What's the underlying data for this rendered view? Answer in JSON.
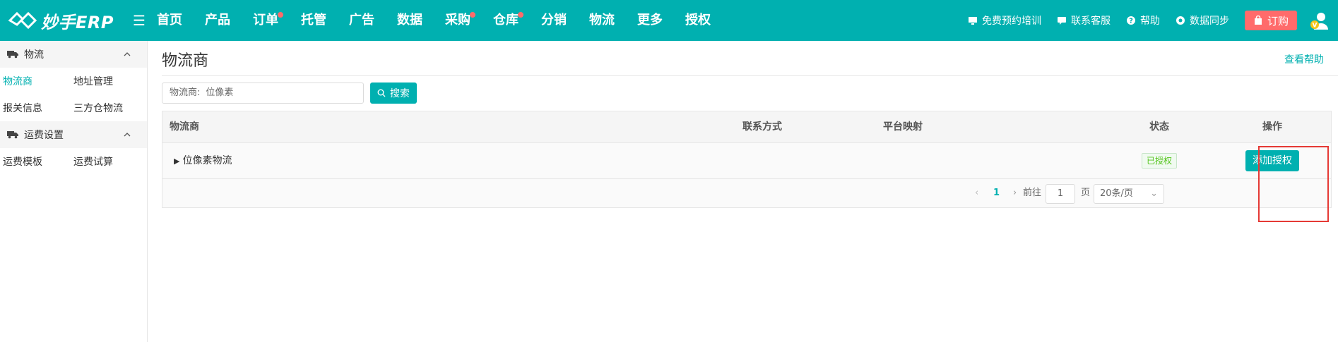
{
  "app": {
    "logo_text": "妙手ERP"
  },
  "topnav": {
    "items": [
      {
        "label": "首页",
        "dot": false
      },
      {
        "label": "产品",
        "dot": false
      },
      {
        "label": "订单",
        "dot": true
      },
      {
        "label": "托管",
        "dot": false
      },
      {
        "label": "广告",
        "dot": false
      },
      {
        "label": "数据",
        "dot": false
      },
      {
        "label": "采购",
        "dot": true
      },
      {
        "label": "仓库",
        "dot": true
      },
      {
        "label": "分销",
        "dot": false
      },
      {
        "label": "物流",
        "dot": false
      },
      {
        "label": "更多",
        "dot": false
      },
      {
        "label": "授权",
        "dot": false
      }
    ],
    "tools": {
      "training": "免费预约培训",
      "service": "联系客服",
      "help": "帮助",
      "sync": "数据同步",
      "order": "订购"
    }
  },
  "sidebar": {
    "group1": {
      "title": "物流",
      "items": [
        "物流商",
        "地址管理",
        "报关信息",
        "三方仓物流"
      ]
    },
    "group2": {
      "title": "运费设置",
      "items": [
        "运费模板",
        "运费试算"
      ]
    }
  },
  "main": {
    "title": "物流商",
    "help_link": "查看帮助",
    "search": {
      "label": "物流商:",
      "value": "位像素",
      "button": "搜索"
    },
    "table": {
      "columns": [
        "物流商",
        "联系方式",
        "平台映射",
        "状态",
        "操作"
      ],
      "rows": [
        {
          "name": "位像素物流",
          "contact": "",
          "mapping": "",
          "status": "已授权",
          "action": "添加授权"
        }
      ]
    },
    "pagination": {
      "current_page": "1",
      "goto_label": "前往",
      "goto_value": "1",
      "page_unit": "页",
      "page_size": "20条/页"
    }
  },
  "colors": {
    "primary": "#00b0b0",
    "danger": "#ff6b6b",
    "success": "#52c41a",
    "highlight": "#e53935"
  }
}
